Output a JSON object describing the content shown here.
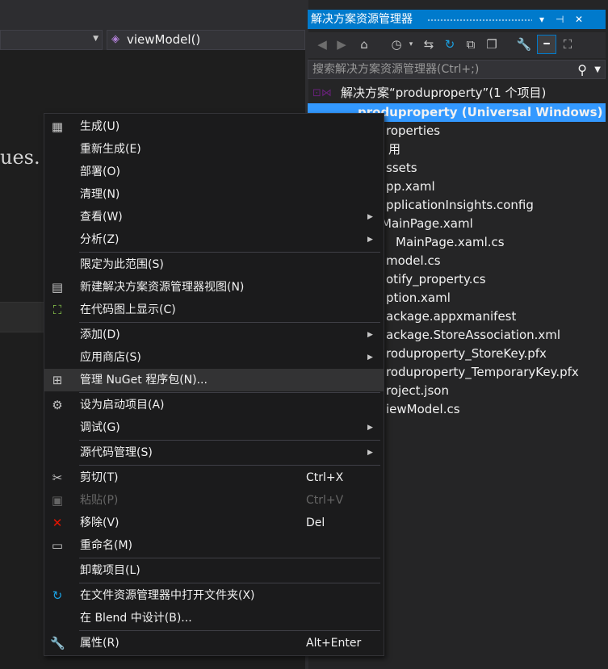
{
  "editor": {
    "nav_member": "viewModel()",
    "code_fragment": "ues."
  },
  "solution_explorer": {
    "title": "解决方案资源管理器",
    "title_pin": "▾ ⊣ ✕",
    "search_placeholder": "搜索解决方案资源管理器(Ctrl+;)",
    "tree": [
      {
        "label": "解决方案“produproperty”(1 个项目)"
      },
      {
        "label": "produproperty (Universal Windows)"
      },
      {
        "label": "roperties"
      },
      {
        "label": "用"
      },
      {
        "label": "ssets"
      },
      {
        "label": "pp.xaml"
      },
      {
        "label": "pplicationInsights.config"
      },
      {
        "label": "MainPage.xaml"
      },
      {
        "label": "MainPage.xaml.cs"
      },
      {
        "label": "model.cs"
      },
      {
        "label": "otify_property.cs"
      },
      {
        "label": "ption.xaml"
      },
      {
        "label": "ackage.appxmanifest"
      },
      {
        "label": "ackage.StoreAssociation.xml"
      },
      {
        "label": "roduproperty_StoreKey.pfx"
      },
      {
        "label": "roduproperty_TemporaryKey.pfx"
      },
      {
        "label": "roject.json"
      },
      {
        "label": "iewModel.cs"
      }
    ]
  },
  "context_menu": {
    "items": [
      {
        "label": "生成(U)",
        "icon": "build-icon"
      },
      {
        "label": "重新生成(E)"
      },
      {
        "label": "部署(O)"
      },
      {
        "label": "清理(N)"
      },
      {
        "label": "查看(W)",
        "submenu": true
      },
      {
        "label": "分析(Z)",
        "submenu": true
      },
      {
        "label": "限定为此范围(S)"
      },
      {
        "label": "新建解决方案资源管理器视图(N)",
        "icon": "new-view-icon"
      },
      {
        "label": "在代码图上显示(C)",
        "icon": "code-map-icon"
      },
      {
        "label": "添加(D)",
        "submenu": true
      },
      {
        "label": "应用商店(S)",
        "submenu": true
      },
      {
        "label": "管理 NuGet 程序包(N)...",
        "icon": "nuget-icon"
      },
      {
        "label": "设为启动项目(A)",
        "icon": "gear-icon"
      },
      {
        "label": "调试(G)",
        "submenu": true
      },
      {
        "label": "源代码管理(S)",
        "submenu": true
      },
      {
        "label": "剪切(T)",
        "shortcut": "Ctrl+X",
        "icon": "scissors-icon"
      },
      {
        "label": "粘贴(P)",
        "shortcut": "Ctrl+V",
        "icon": "paste-icon",
        "disabled": true
      },
      {
        "label": "移除(V)",
        "shortcut": "Del",
        "icon": "remove-icon"
      },
      {
        "label": "重命名(M)",
        "icon": "rename-icon"
      },
      {
        "label": "卸载项目(L)"
      },
      {
        "label": "在文件资源管理器中打开文件夹(X)",
        "icon": "refresh-folder-icon"
      },
      {
        "label": "在 Blend 中设计(B)..."
      },
      {
        "label": "属性(R)",
        "shortcut": "Alt+Enter",
        "icon": "wrench-icon"
      }
    ]
  },
  "colors": {
    "accent": "#007acc",
    "selection": "#3399ff",
    "menu_bg": "#1b1b1c",
    "editor_bg": "#1e1e1e"
  }
}
